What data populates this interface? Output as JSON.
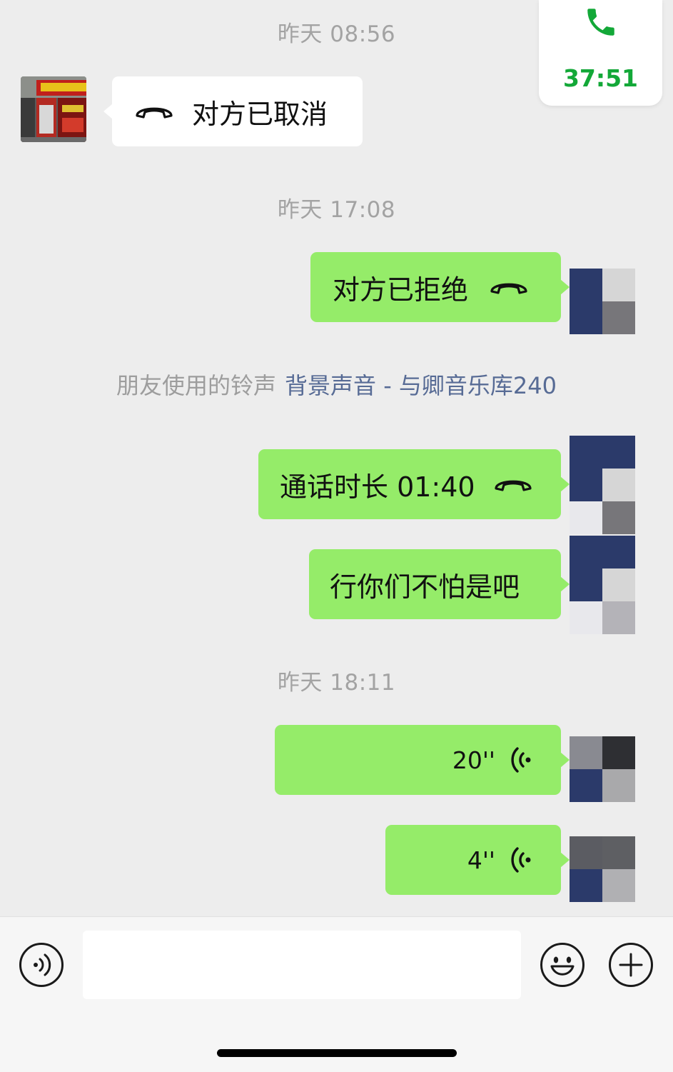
{
  "floating_call": {
    "duration": "37:51",
    "icon": "phone-icon",
    "accent": "#13a838"
  },
  "timestamps": {
    "t1": "昨天 08:56",
    "t2": "昨天 17:08",
    "t3": "昨天 18:11"
  },
  "messages": {
    "m1": {
      "text": "对方已取消",
      "icon": "hangup-icon",
      "side": "left"
    },
    "m2": {
      "text": "对方已拒绝",
      "icon": "hangup-icon",
      "side": "right"
    },
    "m3": {
      "text": "通话时长 01:40",
      "icon": "hangup-icon",
      "side": "right"
    },
    "m4": {
      "text": "行你们不怕是吧",
      "side": "right"
    },
    "m5": {
      "duration": "20''",
      "icon": "voice-wave-icon",
      "side": "right"
    },
    "m6": {
      "duration": "4''",
      "icon": "voice-wave-icon",
      "side": "right"
    }
  },
  "ringtone": {
    "label": "朋友使用的铃声",
    "song": "背景声音 - 与卿音乐库240"
  },
  "input_bar": {
    "voice_icon": "voice-input-icon",
    "emoji_icon": "emoji-icon",
    "plus_icon": "plus-icon",
    "value": ""
  },
  "colors": {
    "background": "#ededed",
    "bubble_green": "#95ec69",
    "bubble_white": "#ffffff",
    "link_blue": "#576b95"
  }
}
